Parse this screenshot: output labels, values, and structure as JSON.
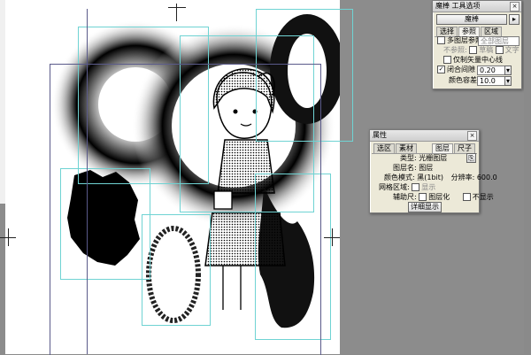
{
  "magic_wand_panel": {
    "title": "魔棒 工具选项",
    "tool_button": "魔棒",
    "tabs": [
      "选择",
      "参照",
      "区域"
    ],
    "reference_label": "多图层参照:",
    "reference_value": "全部图层",
    "unref_label": "不参照:",
    "draft_label": "草稿",
    "text_label": "文字",
    "vector_center_label": "仅制矢量中心线",
    "close_gap_label": "闭合间隙",
    "close_gap_value": "0.20 mm",
    "tolerance_label": "颜色容差:",
    "tolerance_value": "10.0"
  },
  "property_panel": {
    "title": "属性",
    "tabs": [
      "选区",
      "素材",
      "图层",
      "尺子"
    ],
    "type_label": "类型:",
    "type_value": "光栅图层",
    "layer_name_label": "图层名:",
    "layer_name_value": "图层",
    "color_mode_label": "颜色模式:",
    "color_mode_value": "黑(1bit)",
    "resolution_label": "分辨率:",
    "resolution_value": "600.0",
    "screen_label": "网格区域:",
    "screen_value": "显示",
    "aux_label": "辅助尺:",
    "aux_value1": "图层化",
    "aux_value2": "不显示",
    "detail_button": "详细显示"
  }
}
